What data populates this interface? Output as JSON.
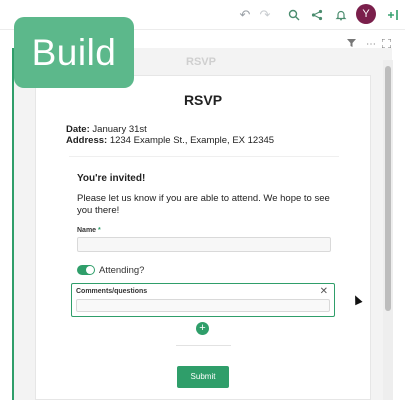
{
  "badge": {
    "label": "Build"
  },
  "topbar": {
    "undo_icon": "undo-icon",
    "redo_icon": "redo-icon",
    "search_icon": "search-icon",
    "share_icon": "share-icon",
    "bell_icon": "bell-icon",
    "avatar_initial": "Y",
    "avatar_color": "#7a1f4b",
    "add_column_icon": "add-column-icon"
  },
  "subbar": {
    "filter_icon": "filter-icon",
    "more_icon": "more-icon",
    "expand_icon": "expand-icon"
  },
  "form": {
    "title": "RSVP",
    "date_label": "Date:",
    "date_value": "January 31st",
    "address_label": "Address:",
    "address_value": "1234 Example St., Example, EX 12345",
    "invited_heading": "You're invited!",
    "invited_body": "Please let us know if you are able to attend. We hope to see you there!",
    "name_label": "Name",
    "required_mark": "*",
    "name_value": "",
    "attending_label": "Attending?",
    "attending_on": true,
    "comments_label": "Comments/questions",
    "comments_value": "",
    "submit_label": "Submit"
  },
  "colors": {
    "accent": "#2f9e6a",
    "badge": "#5cb88b"
  }
}
